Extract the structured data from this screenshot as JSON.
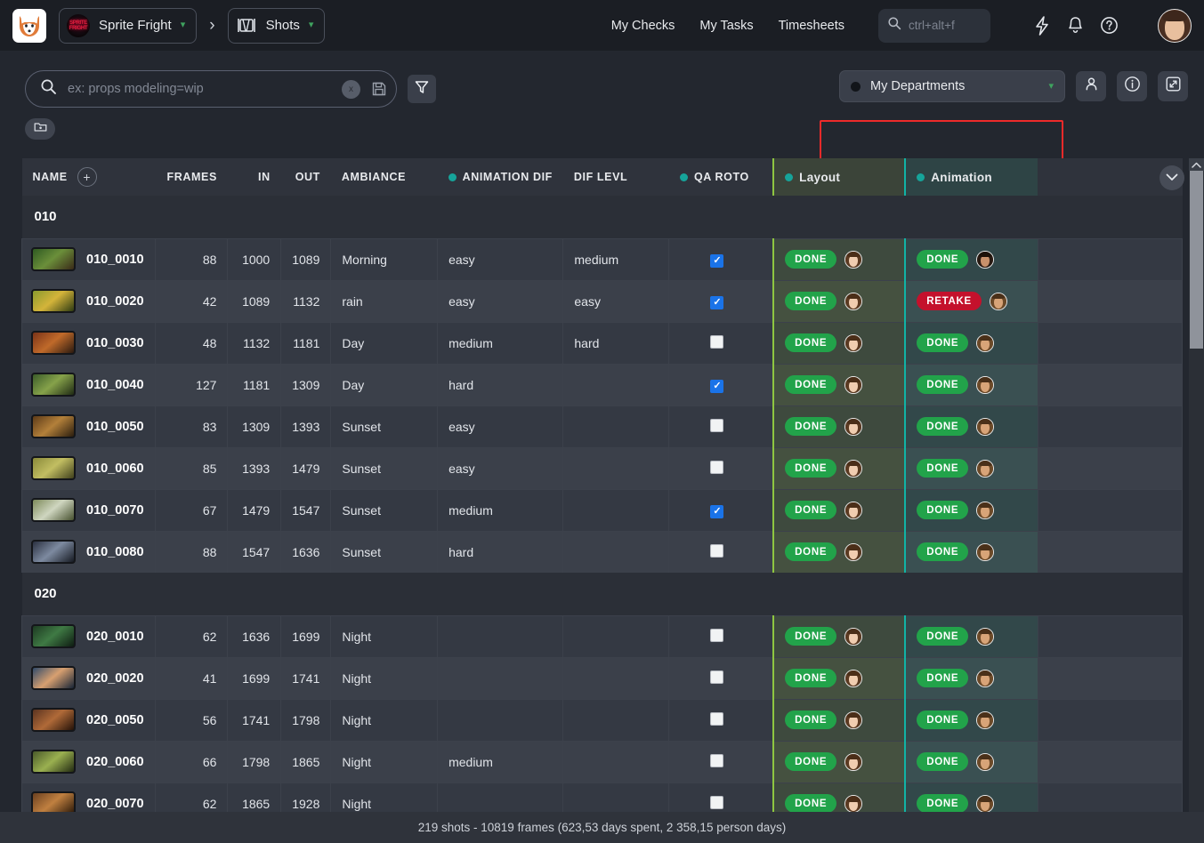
{
  "topbar": {
    "logo_icon": "fox-logo-icon",
    "project": {
      "label": "Sprite Fright",
      "thumb_text": "SPRITE FRIGHT"
    },
    "breadcrumb_separator": "›",
    "section": {
      "label": "Shots",
      "icon": "clapperboard-icon"
    },
    "nav": [
      {
        "label": "My Checks"
      },
      {
        "label": "My Tasks"
      },
      {
        "label": "Timesheets"
      }
    ],
    "search": {
      "placeholder": "ctrl+alt+f",
      "icon": "search-icon"
    },
    "icons": [
      {
        "name": "lightning-bolt-icon"
      },
      {
        "name": "bell-icon"
      },
      {
        "name": "help-circle-icon"
      }
    ],
    "avatar": {
      "name": "user-avatar"
    }
  },
  "filterbar": {
    "search": {
      "placeholder": "ex: props modeling=wip",
      "value": "",
      "clear_label": "x"
    },
    "save_icon": "floppy-save-icon",
    "filter_icon": "funnel-filter-icon",
    "folder_icon": "folder-icon",
    "department_select": {
      "label": "My Departments",
      "chevron": "⌄"
    },
    "person_icon": "person-icon",
    "info_icon": "info-circle-icon",
    "expand_icon": "expand-icon",
    "highlight_color": "#ee2a2a"
  },
  "table": {
    "columns": [
      {
        "key": "name",
        "label": "NAME",
        "dot": false,
        "align": "left"
      },
      {
        "key": "frames",
        "label": "FRAMES",
        "dot": false,
        "align": "right"
      },
      {
        "key": "in",
        "label": "IN",
        "dot": false,
        "align": "right"
      },
      {
        "key": "out",
        "label": "OUT",
        "dot": false,
        "align": "right"
      },
      {
        "key": "ambiance",
        "label": "AMBIANCE",
        "dot": false,
        "align": "left"
      },
      {
        "key": "animdif",
        "label": "ANIMATION DIF",
        "dot": true,
        "align": "left"
      },
      {
        "key": "diflevl",
        "label": "DIF LEVL",
        "dot": false,
        "align": "left"
      },
      {
        "key": "qaroto",
        "label": "QA ROTO",
        "dot": true,
        "align": "left"
      }
    ],
    "task_columns": [
      {
        "key": "layout",
        "label": "Layout",
        "dot_color": "#16a49a",
        "accent": "#8ec641"
      },
      {
        "key": "animation",
        "label": "Animation",
        "dot_color": "#16a49a",
        "accent": "#11b3a6"
      }
    ],
    "add_column_label": "+",
    "collapse_icon": "chevron-down-icon",
    "sequences": [
      {
        "name": "010",
        "rows": [
          {
            "name": "010_0010",
            "frames": "88",
            "in": "1000",
            "out": "1089",
            "ambiance": "Morning",
            "animdif": "easy",
            "diflevl": "medium",
            "qaroto": true,
            "layout": "DONE",
            "animation": "DONE",
            "thumb": "t1",
            "layout_av": "a1",
            "anim_av": "a2"
          },
          {
            "name": "010_0020",
            "frames": "42",
            "in": "1089",
            "out": "1132",
            "ambiance": "rain",
            "animdif": "easy",
            "diflevl": "easy",
            "qaroto": true,
            "layout": "DONE",
            "animation": "RETAKE",
            "thumb": "t2",
            "layout_av": "a1",
            "anim_av": "a3"
          },
          {
            "name": "010_0030",
            "frames": "48",
            "in": "1132",
            "out": "1181",
            "ambiance": "Day",
            "animdif": "medium",
            "diflevl": "hard",
            "qaroto": false,
            "layout": "DONE",
            "animation": "DONE",
            "thumb": "t3",
            "layout_av": "a1",
            "anim_av": "a3"
          },
          {
            "name": "010_0040",
            "frames": "127",
            "in": "1181",
            "out": "1309",
            "ambiance": "Day",
            "animdif": "hard",
            "diflevl": "",
            "qaroto": true,
            "layout": "DONE",
            "animation": "DONE",
            "thumb": "t4",
            "layout_av": "a1",
            "anim_av": "a3"
          },
          {
            "name": "010_0050",
            "frames": "83",
            "in": "1309",
            "out": "1393",
            "ambiance": "Sunset",
            "animdif": "easy",
            "diflevl": "",
            "qaroto": false,
            "layout": "DONE",
            "animation": "DONE",
            "thumb": "t5",
            "layout_av": "a1",
            "anim_av": "a3"
          },
          {
            "name": "010_0060",
            "frames": "85",
            "in": "1393",
            "out": "1479",
            "ambiance": "Sunset",
            "animdif": "easy",
            "diflevl": "",
            "qaroto": false,
            "layout": "DONE",
            "animation": "DONE",
            "thumb": "t6",
            "layout_av": "a1",
            "anim_av": "a3"
          },
          {
            "name": "010_0070",
            "frames": "67",
            "in": "1479",
            "out": "1547",
            "ambiance": "Sunset",
            "animdif": "medium",
            "diflevl": "",
            "qaroto": true,
            "layout": "DONE",
            "animation": "DONE",
            "thumb": "t7",
            "layout_av": "a1",
            "anim_av": "a3"
          },
          {
            "name": "010_0080",
            "frames": "88",
            "in": "1547",
            "out": "1636",
            "ambiance": "Sunset",
            "animdif": "hard",
            "diflevl": "",
            "qaroto": false,
            "layout": "DONE",
            "animation": "DONE",
            "thumb": "t8",
            "layout_av": "a1",
            "anim_av": "a3"
          }
        ]
      },
      {
        "name": "020",
        "rows": [
          {
            "name": "020_0010",
            "frames": "62",
            "in": "1636",
            "out": "1699",
            "ambiance": "Night",
            "animdif": "",
            "diflevl": "",
            "qaroto": false,
            "layout": "DONE",
            "animation": "DONE",
            "thumb": "t9",
            "layout_av": "a1",
            "anim_av": "a3"
          },
          {
            "name": "020_0020",
            "frames": "41",
            "in": "1699",
            "out": "1741",
            "ambiance": "Night",
            "animdif": "",
            "diflevl": "",
            "qaroto": false,
            "layout": "DONE",
            "animation": "DONE",
            "thumb": "t10",
            "layout_av": "a1",
            "anim_av": "a3"
          },
          {
            "name": "020_0050",
            "frames": "56",
            "in": "1741",
            "out": "1798",
            "ambiance": "Night",
            "animdif": "",
            "diflevl": "",
            "qaroto": false,
            "layout": "DONE",
            "animation": "DONE",
            "thumb": "t11",
            "layout_av": "a1",
            "anim_av": "a3"
          },
          {
            "name": "020_0060",
            "frames": "66",
            "in": "1798",
            "out": "1865",
            "ambiance": "Night",
            "animdif": "medium",
            "diflevl": "",
            "qaroto": false,
            "layout": "DONE",
            "animation": "DONE",
            "thumb": "t12",
            "layout_av": "a1",
            "anim_av": "a3"
          },
          {
            "name": "020_0070",
            "frames": "62",
            "in": "1865",
            "out": "1928",
            "ambiance": "Night",
            "animdif": "",
            "diflevl": "",
            "qaroto": false,
            "layout": "DONE",
            "animation": "DONE",
            "thumb": "t13",
            "layout_av": "a1",
            "anim_av": "a3"
          }
        ]
      }
    ]
  },
  "footer": {
    "summary": "219 shots - 10819 frames (623,53 days spent, 2 358,15 person days)"
  },
  "colors": {
    "status_done": "#22a34a",
    "status_retake": "#c4112c",
    "accent_teal": "#16a49a",
    "accent_green": "#8ec641",
    "checkbox_checked": "#1a73e8"
  }
}
